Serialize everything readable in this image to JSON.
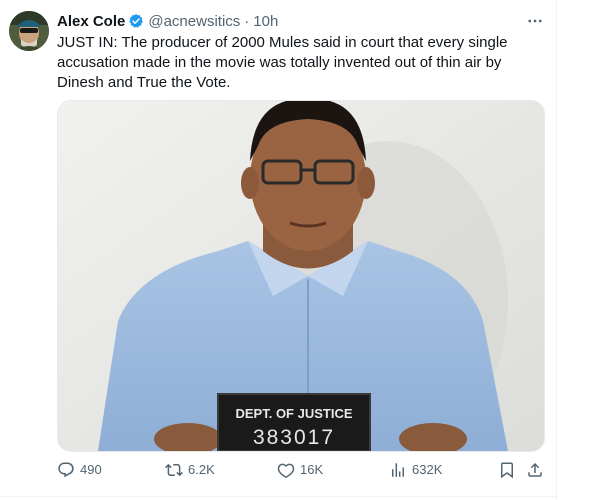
{
  "tweet": {
    "author_name": "Alex Cole",
    "author_handle": "@acnewsitics",
    "separator": "·",
    "time": "10h",
    "text": "JUST IN: The producer of 2000 Mules said in court that every single accusation made in the movie was totally invented out of thin air by Dinesh and True the Vote.",
    "media": {
      "placard_line1": "DEPT. OF JUSTICE",
      "placard_line2": "383017"
    },
    "stats": {
      "replies": "490",
      "reposts": "6.2K",
      "likes": "16K",
      "views": "632K"
    }
  },
  "colors": {
    "text_primary": "#0f1419",
    "text_secondary": "#536471",
    "verified": "#1d9bf0"
  }
}
